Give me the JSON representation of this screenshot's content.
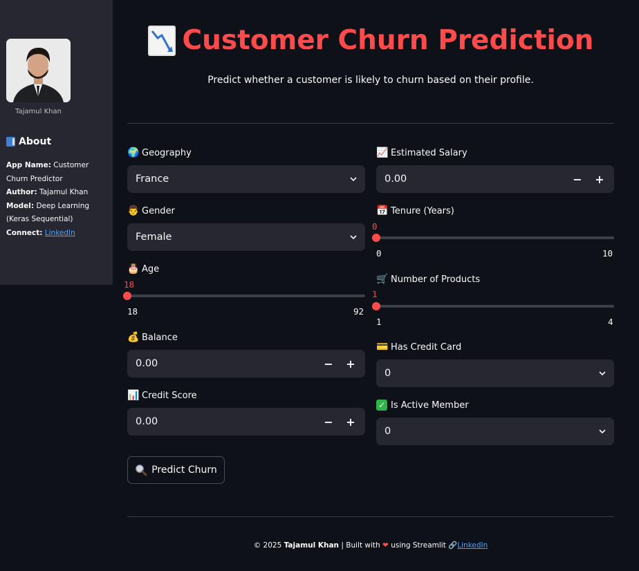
{
  "sidebar": {
    "author_caption": "Tajamul Khan",
    "about_title": "About",
    "about": [
      {
        "label": "App Name:",
        "value": "Customer Churn Predictor"
      },
      {
        "label": "Author:",
        "value": "Tajamul Khan"
      },
      {
        "label": "Model:",
        "value": "Deep Learning (Keras Sequential)"
      },
      {
        "label": "Connect:",
        "value": "LinkedIn"
      }
    ]
  },
  "header": {
    "title": "Customer Churn Prediction",
    "subtitle": "Predict whether a customer is likely to churn based on their profile."
  },
  "form": {
    "geography": {
      "label": "Geography",
      "value": "France",
      "icon": "globe-icon"
    },
    "gender": {
      "label": "Gender",
      "value": "Female",
      "icon": "person-icon"
    },
    "age": {
      "label": "Age",
      "value": "18",
      "min": "18",
      "max": "92",
      "icon": "cake-icon"
    },
    "balance": {
      "label": "Balance",
      "value": "0.00",
      "icon": "money-bag-icon"
    },
    "credit_score": {
      "label": "Credit Score",
      "value": "0.00",
      "icon": "bar-chart-icon"
    },
    "estimated_salary": {
      "label": "Estimated Salary",
      "value": "0.00",
      "icon": "trend-up-icon"
    },
    "tenure": {
      "label": "Tenure (Years)",
      "value": "0",
      "min": "0",
      "max": "10",
      "icon": "calendar-icon"
    },
    "num_products": {
      "label": "Number of Products",
      "value": "1",
      "min": "1",
      "max": "4",
      "icon": "cart-icon"
    },
    "has_credit_card": {
      "label": "Has Credit Card",
      "value": "0",
      "icon": "credit-card-icon"
    },
    "is_active_member": {
      "label": "Is Active Member",
      "value": "0",
      "icon": "check-icon"
    },
    "minus": "−",
    "plus": "+"
  },
  "predict_button": {
    "label": "Predict Churn",
    "icon": "magnifier-icon"
  },
  "footer": {
    "copyright": "© 2025",
    "author": "Tajamul Khan",
    "built_with": "| Built with",
    "using": "using Streamlit",
    "link": "LinkedIn"
  },
  "colors": {
    "accent": "#ff4b4b",
    "bg": "#0e1117",
    "panel": "#262730",
    "link": "#4aa3ff"
  }
}
